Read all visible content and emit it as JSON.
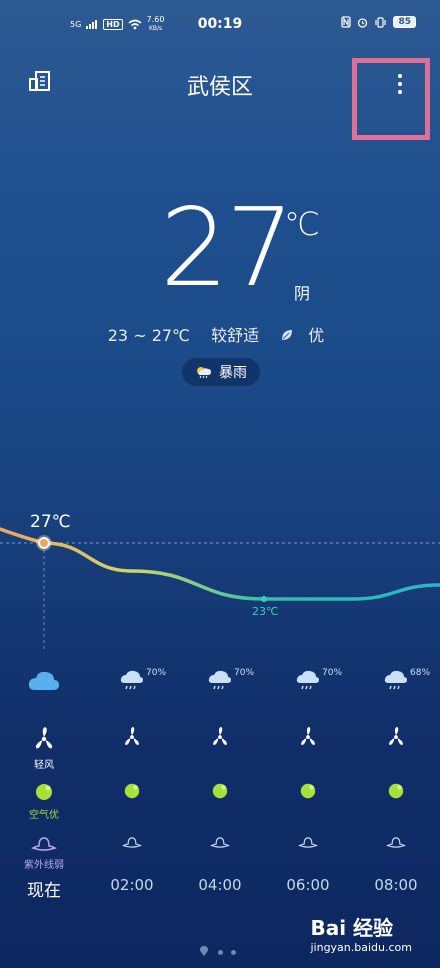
{
  "status": {
    "time": "00:19",
    "network": "5G",
    "hd": "HD",
    "speed_val": "7.60",
    "speed_unit": "KB/s",
    "battery": "85"
  },
  "header": {
    "city": "武侯区"
  },
  "current": {
    "temp": "27",
    "unit": "℃",
    "condition": "阴",
    "range": "23 ~ 27℃",
    "comfort": "较舒适",
    "air": "优",
    "alert": "暴雨"
  },
  "chart_data": {
    "type": "line",
    "x": [
      "现在",
      "02:00",
      "04:00",
      "06:00",
      "08:00"
    ],
    "series": [
      {
        "values": [
          27,
          25,
          23,
          23,
          24
        ]
      }
    ],
    "labels": [
      {
        "text": "27℃",
        "at": "现在"
      },
      {
        "text": "23℃",
        "at": "04:00"
      }
    ]
  },
  "hourly": [
    {
      "time": "现在",
      "precip": "",
      "wind": "轻风",
      "air": "空气优",
      "uv": "紫外线弱"
    },
    {
      "time": "02:00",
      "precip": "70%"
    },
    {
      "time": "04:00",
      "precip": "70%"
    },
    {
      "time": "06:00",
      "precip": "70%"
    },
    {
      "time": "08:00",
      "precip": "68%"
    }
  ],
  "watermark": {
    "brand": "Bai 经验",
    "url": "jingyan.baidu.com"
  }
}
